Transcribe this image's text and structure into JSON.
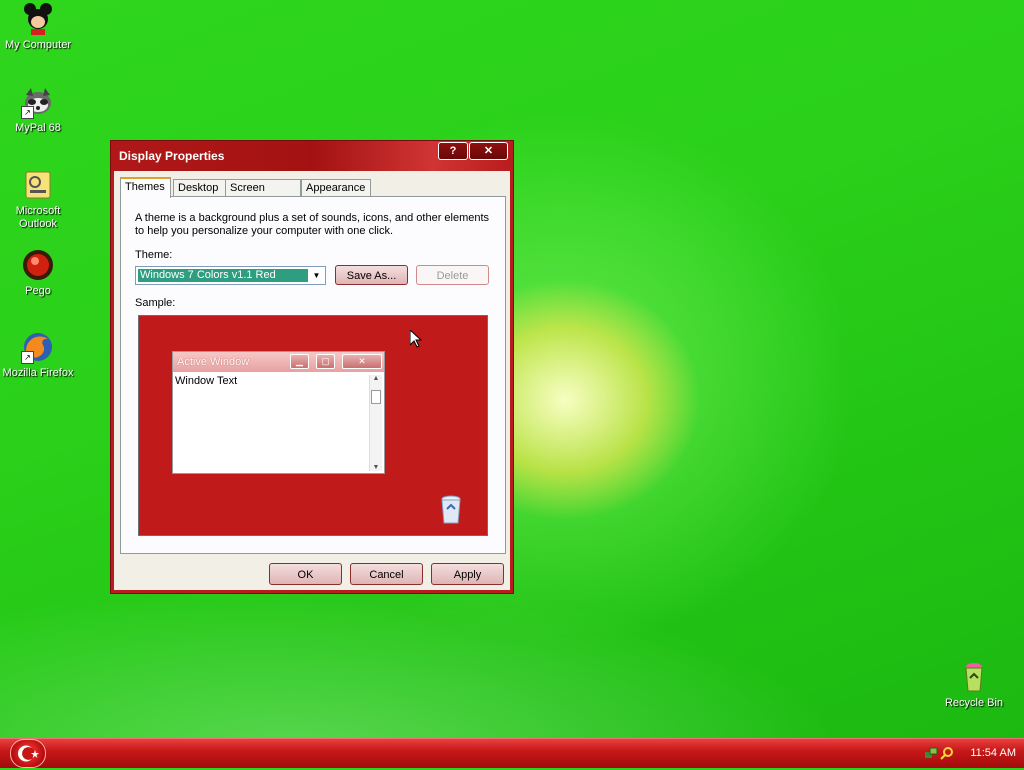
{
  "desktop": {
    "icons": [
      {
        "label": "My Computer",
        "icon": "mickey-icon"
      },
      {
        "label": "MyPal 68",
        "icon": "raccoon-icon"
      },
      {
        "label": "Microsoft Outlook",
        "icon": "outlook-icon"
      },
      {
        "label": "Pego",
        "icon": "pego-icon"
      },
      {
        "label": "Mozilla Firefox",
        "icon": "firefox-icon"
      }
    ],
    "recycle_bin": {
      "label": "Recycle Bin",
      "icon": "recycle-bin-icon"
    },
    "background_color": "#2ed61c"
  },
  "dialog": {
    "title": "Display Properties",
    "help_label": "?",
    "close_label": "✕",
    "tabs": [
      {
        "label": "Themes",
        "active": true
      },
      {
        "label": "Desktop",
        "active": false
      },
      {
        "label": "Screen Saver",
        "active": false
      },
      {
        "label": "Appearance",
        "active": false
      }
    ],
    "description": "A theme is a background plus a set of sounds, icons, and other elements to help you personalize your computer with one click.",
    "theme_label": "Theme:",
    "theme_value": "Windows 7 Colors v1.1 Red",
    "save_as_label": "Save As...",
    "delete_label": "Delete",
    "sample_label": "Sample:",
    "sample": {
      "window_title": "Active Window",
      "window_text": "Window Text",
      "background_color": "#c01a1a"
    },
    "ok_label": "OK",
    "cancel_label": "Cancel",
    "apply_label": "Apply",
    "accent_color": "#b81c1c"
  },
  "taskbar": {
    "clock": "11:54 AM",
    "color": "#c81818"
  }
}
